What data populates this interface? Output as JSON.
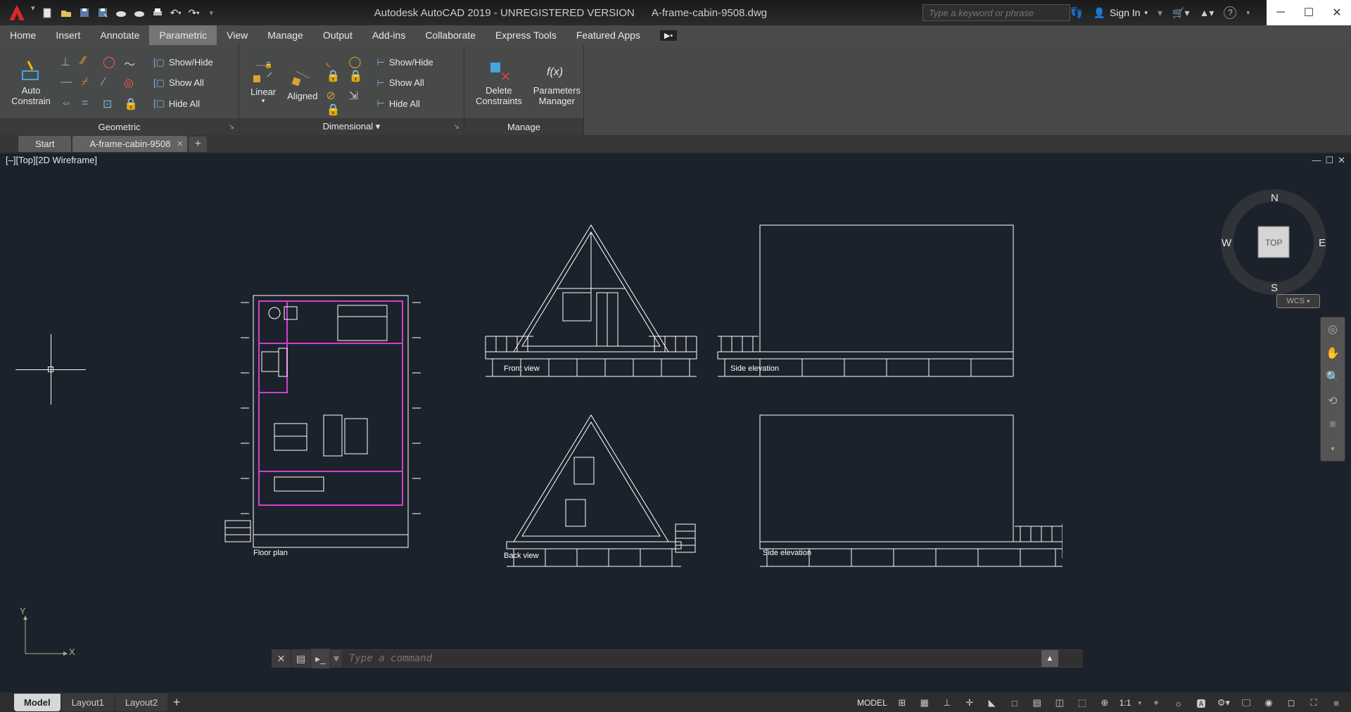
{
  "title": {
    "app": "Autodesk AutoCAD 2019 - UNREGISTERED VERSION",
    "file": "A-frame-cabin-9508.dwg"
  },
  "search": {
    "placeholder": "Type a keyword or phrase"
  },
  "signin": "Sign In",
  "ribbonTabs": [
    "Home",
    "Insert",
    "Annotate",
    "Parametric",
    "View",
    "Manage",
    "Output",
    "Add-ins",
    "Collaborate",
    "Express Tools",
    "Featured Apps"
  ],
  "activeRibbon": "Parametric",
  "panels": {
    "geometric": {
      "title": "Geometric",
      "auto": "Auto\nConstrain",
      "showHide": "Show/Hide",
      "showAll": "Show All",
      "hideAll": "Hide All"
    },
    "dimensional": {
      "title": "Dimensional ▾",
      "linear": "Linear",
      "aligned": "Aligned",
      "showHide": "Show/Hide",
      "showAll": "Show All",
      "hideAll": "Hide All"
    },
    "manage": {
      "title": "Manage",
      "delete": "Delete\nConstraints",
      "params": "Parameters\nManager"
    }
  },
  "fileTabs": [
    "Start",
    "A-frame-cabin-9508"
  ],
  "activeFile": "A-frame-cabin-9508",
  "viewportLabel": "[–][Top][2D Wireframe]",
  "compass": {
    "n": "N",
    "e": "E",
    "s": "S",
    "w": "W",
    "top": "TOP"
  },
  "wcs": "WCS",
  "drawingLabels": {
    "floor": "Floor plan",
    "front": "Front view",
    "back": "Back view",
    "side1": "Side elevation",
    "side2": "Side elevation"
  },
  "cmd": {
    "placeholder": "Type a command"
  },
  "layoutTabs": [
    "Model",
    "Layout1",
    "Layout2"
  ],
  "activeLayout": "Model",
  "status": {
    "model": "MODEL",
    "scale": "1:1"
  },
  "ucs": {
    "x": "X",
    "y": "Y"
  }
}
